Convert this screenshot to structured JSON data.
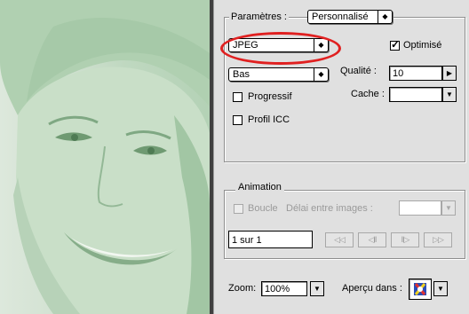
{
  "settings": {
    "label": "Paramètres :",
    "preset": "Personnalisé",
    "format": "JPEG",
    "optimized_label": "Optimisé",
    "optimized_checked": true,
    "quality_preset": "Bas",
    "quality_label": "Qualité :",
    "quality_value": "10",
    "progressive_label": "Progressif",
    "progressive_checked": false,
    "blur_label": "Cache :",
    "icc_label": "Profil ICC",
    "icc_checked": false
  },
  "animation": {
    "title": "Animation",
    "loop_label": "Boucle",
    "loop_checked": false,
    "delay_label": "Délai entre images :",
    "frame_counter": "1 sur 1",
    "buttons": [
      "◁◁",
      "◁‖",
      "‖▷",
      "▷▷"
    ]
  },
  "footer": {
    "zoom_label": "Zoom:",
    "zoom_value": "100%",
    "preview_in_label": "Aperçu dans :"
  },
  "icons": {
    "popup_arrow": "updown-arrows-icon",
    "stepper": "right-arrow-icon",
    "dropdown": "down-arrow-icon",
    "browser": "browser-icon"
  },
  "colors": {
    "highlight": "#e02020",
    "panel_bg": "#e0e0e0",
    "preview_tint": "#c4dcc4"
  }
}
